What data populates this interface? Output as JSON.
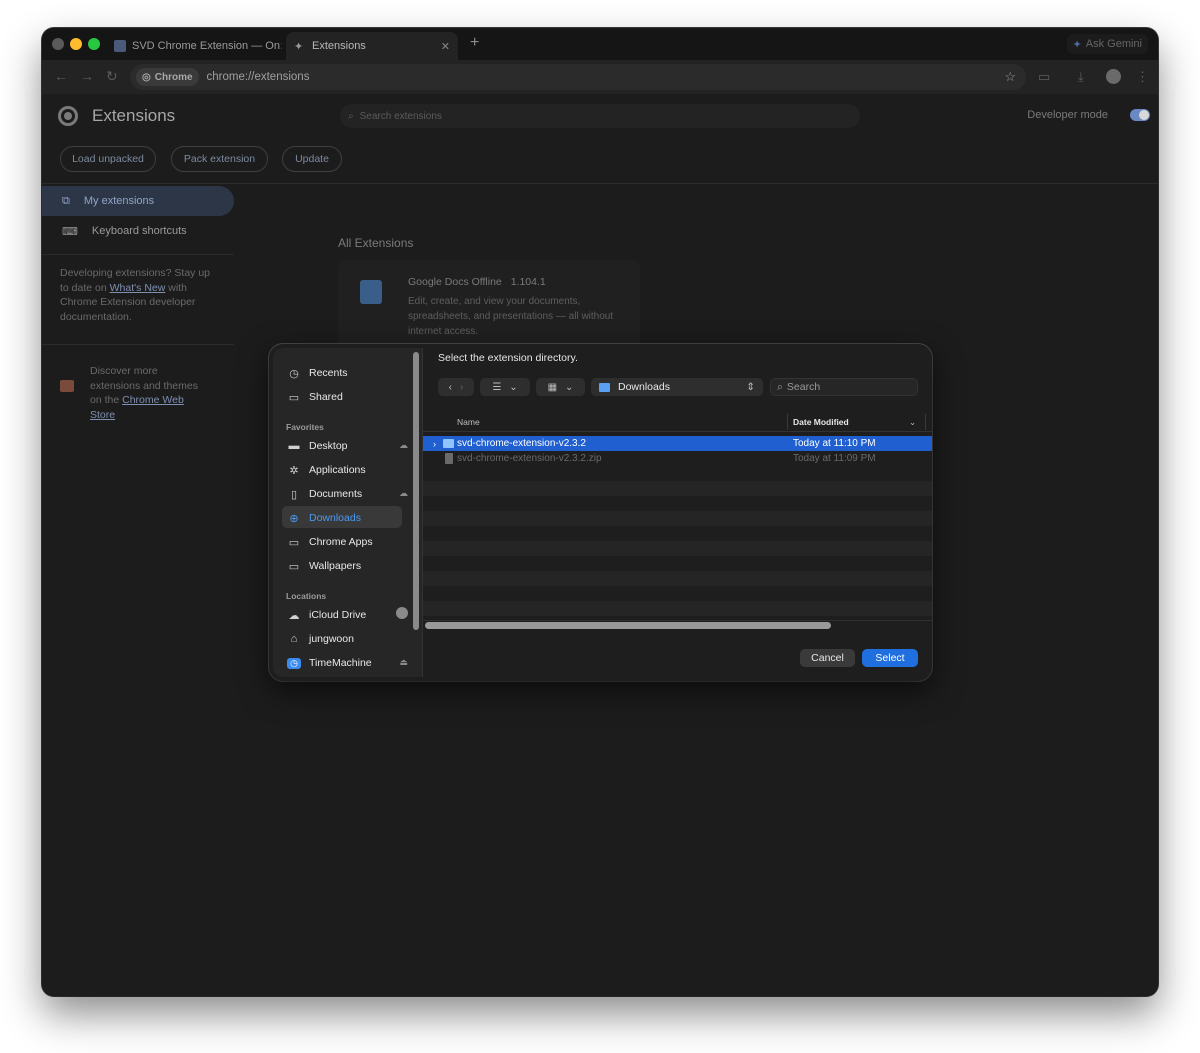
{
  "browser": {
    "tabs": [
      {
        "label": "SVD Chrome Extension — On",
        "active": false
      },
      {
        "label": "Extensions",
        "active": true
      }
    ],
    "gemini_label": "Ask Gemini",
    "omnibox": {
      "chip": "Chrome",
      "url": "chrome://extensions"
    }
  },
  "extensions_page": {
    "title": "Extensions",
    "search_placeholder": "Search extensions",
    "developer_mode_label": "Developer mode",
    "developer_mode_on": true,
    "buttons": {
      "load_unpacked": "Load unpacked",
      "pack_extension": "Pack extension",
      "update": "Update"
    },
    "sidebar": {
      "my_extensions": "My extensions",
      "keyboard_shortcuts": "Keyboard shortcuts",
      "dev_note_1": "Developing extensions? Stay up to date on",
      "dev_note_link": "What's New",
      "dev_note_2": "with Chrome Extension developer documentation.",
      "discover_1": "Discover more extensions and themes on the",
      "discover_link": "Chrome Web Store"
    },
    "section_title": "All Extensions",
    "card": {
      "name": "Google Docs Offline",
      "version": "1.104.1",
      "description": "Edit, create, and view your documents, spreadsheets, and presentations — all without internet access."
    }
  },
  "dialog": {
    "prompt": "Select the extension directory.",
    "location": "Downloads",
    "search_placeholder": "Search",
    "sidebar": {
      "top": [
        {
          "label": "Recents",
          "icon": "clock-icon"
        },
        {
          "label": "Shared",
          "icon": "shared-folder-icon"
        }
      ],
      "favorites_header": "Favorites",
      "favorites": [
        {
          "label": "Desktop",
          "icon": "desktop-icon"
        },
        {
          "label": "Applications",
          "icon": "applications-icon"
        },
        {
          "label": "Documents",
          "icon": "document-icon"
        },
        {
          "label": "Downloads",
          "icon": "download-icon",
          "selected": true
        },
        {
          "label": "Chrome Apps",
          "icon": "folder-icon"
        },
        {
          "label": "Wallpapers",
          "icon": "folder-icon"
        }
      ],
      "locations_header": "Locations",
      "locations": [
        {
          "label": "iCloud Drive",
          "icon": "cloud-icon"
        },
        {
          "label": "jungwoon",
          "icon": "home-icon"
        },
        {
          "label": "TimeMachine",
          "icon": "timemachine-icon"
        }
      ]
    },
    "columns": {
      "name": "Name",
      "date_modified": "Date Modified"
    },
    "files": [
      {
        "name": "svd-chrome-extension-v2.3.2",
        "date": "Today at 11:10 PM",
        "kind": "folder",
        "selected": true
      },
      {
        "name": "svd-chrome-extension-v2.3.2.zip",
        "date": "Today at 11:09 PM",
        "kind": "zip",
        "selected": false
      }
    ],
    "buttons": {
      "cancel": "Cancel",
      "select": "Select"
    },
    "colors": {
      "accent": "#1f6fe0",
      "selection": "#1f5fd0",
      "folder": "#5aa2ef"
    }
  }
}
